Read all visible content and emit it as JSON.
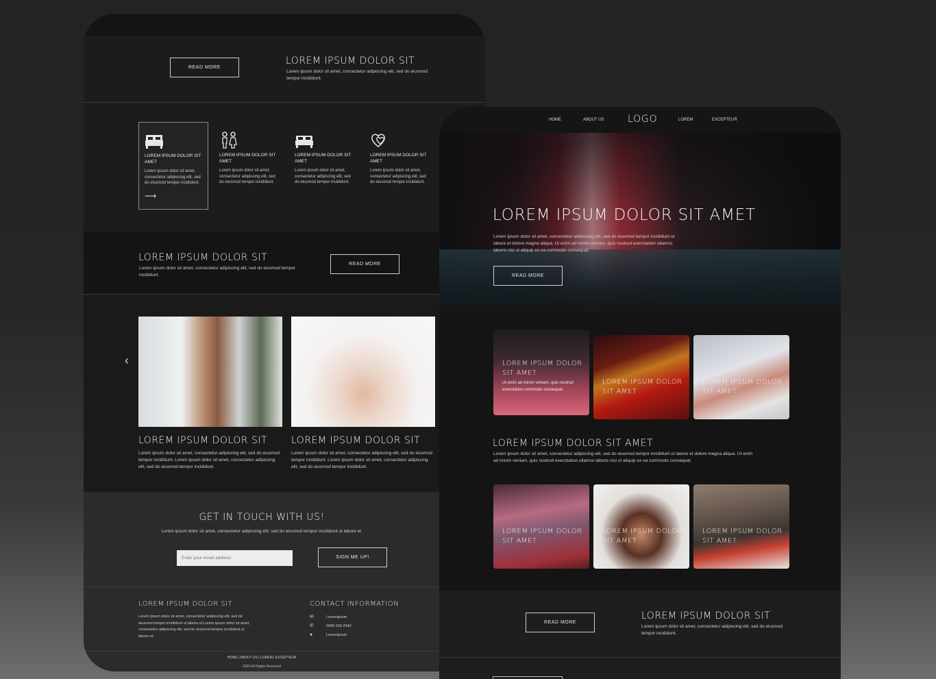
{
  "left": {
    "section1": {
      "button": "READ MORE",
      "title": "LOREM IPSUM DOLOR SIT",
      "text": "Lorem ipsum dolor sit amet, consectetur adipiscing elit, sed do eiusmod tempor incididunt."
    },
    "features": [
      {
        "icon": "bed-icon",
        "title": "LOREM IPSUM DOLOR SIT AMET",
        "text": "Lorem ipsum dolor sit amet, consectetur adipiscing elit, sed do eiusmod tempor incididunt.",
        "arrow": "⟶"
      },
      {
        "icon": "couple-icon",
        "title": "LOREM IPSUM DOLOR SIT AMET",
        "text": "Lorem ipsum dolor sit amet, consectetur adipiscing elit, sed do eiusmod tempor incididunt."
      },
      {
        "icon": "bed-icon",
        "title": "LOREM IPSUM DOLOR SIT AMET",
        "text": "Lorem ipsum dolor sit amet, consectetur adipiscing elit, sed do eiusmod tempor incididunt."
      },
      {
        "icon": "hearts-icon",
        "title": "LOREM IPSUM DOLOR SIT AMET",
        "text": "Lorem ipsum dolor sit amet, consectetur adipiscing elit, sed do eiusmod tempor incididunt."
      }
    ],
    "banner": {
      "title": "LOREM IPSUM DOLOR SIT",
      "text": "Lorem ipsum dolor sit amet, consectetur adipiscing elit, sed do eiusmod tempor incididunt.",
      "button": "READ MORE"
    },
    "gallery": {
      "prev_icon": "chevron-left-icon",
      "cards": [
        {
          "title": "LOREM IPSUM DOLOR SIT",
          "text": "Lorem ipsum dolor sit amet, consectetur adipiscing elit, sed do eiusmod tempor incididunt. Lorem ipsum dolor sit amet, consectetur adipiscing elit, sed do eiusmod tempor incididunt."
        },
        {
          "title": "LOREM IPSUM DOLOR SIT",
          "text": "Lorem ipsum dolor sit amet, consectetur adipiscing elit, sed do eiusmod tempor incididunt. Lorem ipsum dolor sit amet, consectetur adipiscing elit, sed do eiusmod tempor incididunt."
        }
      ]
    },
    "contact": {
      "title": "GET IN TOUCH WITH US!",
      "text": "Lorem ipsum dolor sit amet, consectetur adipiscing elit, sed do eiusmod tempor incididunt ut labore et.",
      "email_placeholder": "Enter your email address",
      "button": "SIGN ME UP!"
    },
    "footer": {
      "about_title": "LOREM IPSUM DOLOR SIT",
      "about_text": "Lorem ipsum dolor sit amet, consectetur adipiscing elit, sed do eiusmod tempor incididunt ut labore et.Lorem ipsum dolor sit amet, consectetur adipiscing elit, sed do eiusmod tempor incididunt ut labore et.",
      "contact_title": "CONTACT INFORMATION",
      "contact_items": [
        {
          "icon": "mail-icon",
          "text": "Loremipsum"
        },
        {
          "icon": "phone-icon",
          "text": "0908 324 2342"
        },
        {
          "icon": "globe-icon",
          "text": "Loremipsum"
        }
      ],
      "links": "HOME | ABOUT US | LOREM | EXCEPTEUR",
      "copyright": "2020 All Rights Reserved"
    }
  },
  "right": {
    "nav": {
      "items": [
        "HOME",
        "ABOUT US",
        "LOREM",
        "EXCEPTEUR"
      ],
      "logo": "LOGO"
    },
    "hero": {
      "title": "LOREM IPSUM DOLOR SIT AMET",
      "text": "Lorem ipsum dolor sit amet, consectetur adipiscing elit, sed do eiusmod tempor incididunt ut labore et dolore magna aliqua. Ut enim ad minim veniam, quis nostrud exercitation ullamco laboris nisi ut aliquip ex ea commodo consequat.",
      "button": "READ MORE"
    },
    "tiles_row1": [
      {
        "title": "LOREM IPSUM DOLOR SIT AMET",
        "text": "Ut enim ad minim veniam, quis nostrud exercitation commodo consequat."
      },
      {
        "title": "LOREM IPSUM DOLOR SIT AMET"
      },
      {
        "title": "LOREM IPSUM DOLOR SIT AMET"
      }
    ],
    "section2": {
      "title": "LOREM IPSUM DOLOR SIT AMET",
      "text": "Lorem ipsum dolor sit amet, consectetur adipiscing elit, sed do eiusmod tempor incididunt ut labore et dolore magna aliqua. Ut enim ad minim veniam, quis nostrud exercitation ullamco laboris nisi ut aliquip ex ea commodo consequat."
    },
    "tiles_row2": [
      {
        "title": "LOREM IPSUM DOLOR SIT AMET"
      },
      {
        "title": "LOREM IPSUM DOLOR SIT AMET"
      },
      {
        "title": "LOREM IPSUM DOLOR SIT AMET"
      }
    ],
    "section3": {
      "button": "READ MORE",
      "title": "LOREM IPSUM DOLOR SIT",
      "text": "Lorem ipsum dolor sit amet, consectetur adipiscing elit, sed do eiusmod tempor incididunt."
    }
  }
}
